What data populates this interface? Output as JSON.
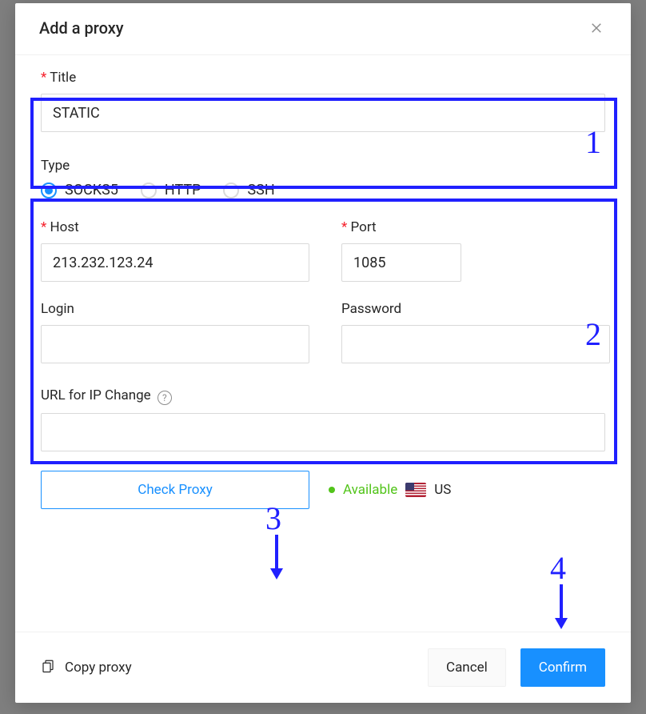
{
  "modal": {
    "title": "Add a proxy"
  },
  "title_field": {
    "label": "Title",
    "value": "STATIC"
  },
  "type_field": {
    "label": "Type",
    "options": [
      "SOCKS5",
      "HTTP",
      "SSH"
    ],
    "selected": "SOCKS5"
  },
  "host_field": {
    "label": "Host",
    "value": "213.232.123.24"
  },
  "port_field": {
    "label": "Port",
    "value": "1085"
  },
  "login_field": {
    "label": "Login",
    "value": ""
  },
  "password_field": {
    "label": "Password",
    "value": ""
  },
  "url_change": {
    "label": "URL for IP Change",
    "value": ""
  },
  "check": {
    "button_label": "Check Proxy"
  },
  "status": {
    "text": "Available",
    "country": "US"
  },
  "footer": {
    "copy_label": "Copy proxy",
    "cancel_label": "Cancel",
    "confirm_label": "Confirm"
  },
  "annotations": {
    "box1": "1",
    "box2": "2",
    "num3": "3",
    "num4": "4"
  },
  "colors": {
    "primary": "#1890ff",
    "annotation": "#2020ff",
    "available": "#52c41a"
  }
}
